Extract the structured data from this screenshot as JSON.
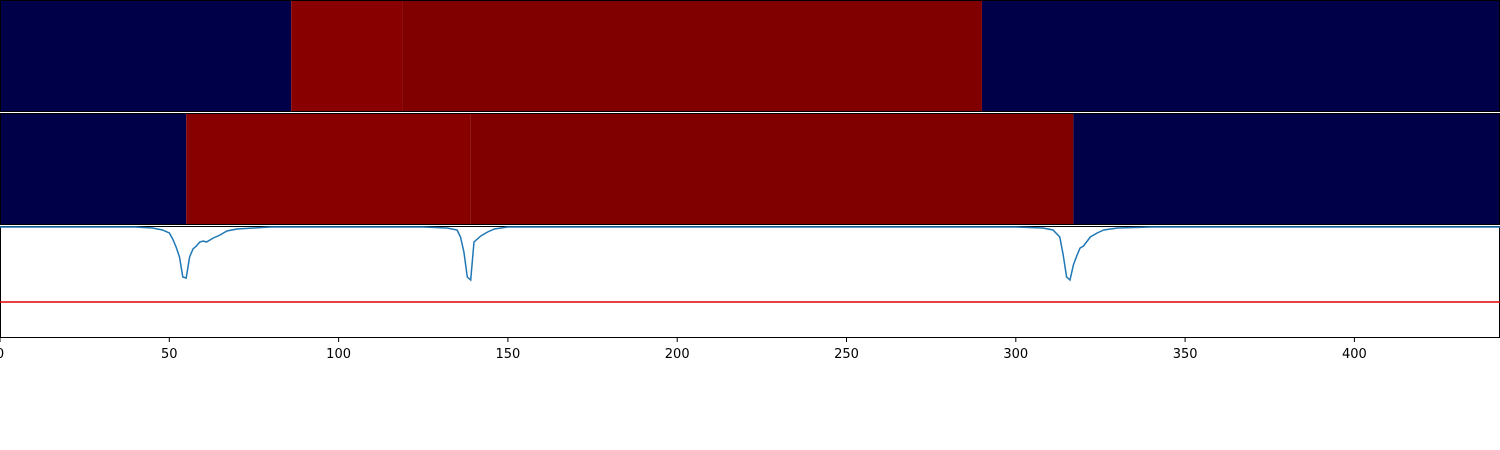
{
  "chart_data": [
    {
      "type": "heatmap",
      "colors": {
        "low": "#000048",
        "high": "#880000",
        "high_dark": "#800000"
      },
      "segments": [
        {
          "start": 0,
          "end": 86,
          "level": "low"
        },
        {
          "start": 86,
          "end": 119,
          "level": "high"
        },
        {
          "start": 119,
          "end": 290,
          "level": "high_dark"
        },
        {
          "start": 290,
          "end": 443,
          "level": "low"
        }
      ]
    },
    {
      "type": "heatmap",
      "colors": {
        "low": "#000048",
        "high": "#880000",
        "high_dark": "#800000"
      },
      "segments": [
        {
          "start": 0,
          "end": 55,
          "level": "low"
        },
        {
          "start": 55,
          "end": 139,
          "level": "high"
        },
        {
          "start": 139,
          "end": 317,
          "level": "high_dark"
        },
        {
          "start": 317,
          "end": 443,
          "level": "low"
        }
      ]
    },
    {
      "type": "line",
      "x_ticks": [
        "0",
        "50",
        "100",
        "150",
        "200",
        "250",
        "300",
        "350",
        "400"
      ],
      "xlim": [
        0,
        443
      ],
      "ylim": [
        -0.1,
        1.0
      ],
      "threshold": {
        "value": 0.25,
        "color": "#dd0000"
      },
      "series": [
        {
          "color": "#1f77b4",
          "points": [
            [
              0,
              1.0
            ],
            [
              40,
              1.0
            ],
            [
              45,
              0.99
            ],
            [
              48,
              0.97
            ],
            [
              50,
              0.94
            ],
            [
              51,
              0.88
            ],
            [
              52,
              0.8
            ],
            [
              53,
              0.7
            ],
            [
              54,
              0.5
            ],
            [
              55,
              0.49
            ],
            [
              56,
              0.7
            ],
            [
              57,
              0.78
            ],
            [
              58,
              0.81
            ],
            [
              59,
              0.85
            ],
            [
              60,
              0.86
            ],
            [
              61,
              0.85
            ],
            [
              63,
              0.89
            ],
            [
              65,
              0.92
            ],
            [
              67,
              0.96
            ],
            [
              70,
              0.98
            ],
            [
              75,
              0.99
            ],
            [
              80,
              1.0
            ],
            [
              125,
              1.0
            ],
            [
              132,
              0.99
            ],
            [
              135,
              0.97
            ],
            [
              136,
              0.9
            ],
            [
              137,
              0.75
            ],
            [
              138,
              0.5
            ],
            [
              139,
              0.47
            ],
            [
              140,
              0.85
            ],
            [
              142,
              0.91
            ],
            [
              144,
              0.95
            ],
            [
              146,
              0.98
            ],
            [
              150,
              1.0
            ],
            [
              300,
              1.0
            ],
            [
              308,
              0.99
            ],
            [
              311,
              0.97
            ],
            [
              313,
              0.9
            ],
            [
              314,
              0.72
            ],
            [
              315,
              0.5
            ],
            [
              316,
              0.47
            ],
            [
              317,
              0.62
            ],
            [
              318,
              0.71
            ],
            [
              319,
              0.79
            ],
            [
              320,
              0.81
            ],
            [
              322,
              0.9
            ],
            [
              324,
              0.94
            ],
            [
              326,
              0.97
            ],
            [
              330,
              0.99
            ],
            [
              340,
              1.0
            ],
            [
              443,
              1.0
            ]
          ]
        }
      ]
    }
  ]
}
